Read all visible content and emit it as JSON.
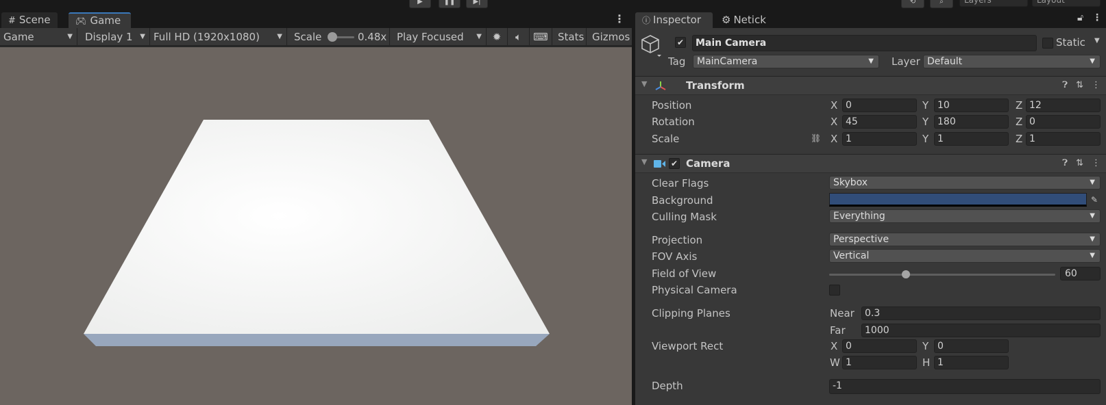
{
  "toolbar": {
    "play": "▶",
    "pause": "❚❚",
    "step": "▶|",
    "layers": "Layers",
    "layout": "Layout"
  },
  "game_panel": {
    "tabs": [
      {
        "label": "Scene",
        "icon": "grid-icon"
      },
      {
        "label": "Game",
        "icon": "gamepad-icon"
      }
    ],
    "toolbar": {
      "mode": "Game",
      "display": "Display 1",
      "resolution": "Full HD (1920x1080)",
      "scale_label": "Scale",
      "scale_value": "0.48x",
      "scale_fraction": 0.1,
      "play_mode": "Play Focused",
      "stats": "Stats",
      "gizmos": "Gizmos"
    }
  },
  "inspector": {
    "tabs": [
      {
        "label": "Inspector",
        "icon": "info-icon"
      },
      {
        "label": "Netick",
        "icon": "gear-icon"
      }
    ],
    "object": {
      "name": "Main Camera",
      "active": true,
      "static_label": "Static",
      "tag_label": "Tag",
      "tag": "MainCamera",
      "layer_label": "Layer",
      "layer": "Default"
    },
    "transform": {
      "title": "Transform",
      "position_label": "Position",
      "rotation_label": "Rotation",
      "scale_label": "Scale",
      "position": {
        "x": "0",
        "y": "10",
        "z": "12"
      },
      "rotation": {
        "x": "45",
        "y": "180",
        "z": "0"
      },
      "scale": {
        "x": "1",
        "y": "1",
        "z": "1"
      },
      "axis_x": "X",
      "axis_y": "Y",
      "axis_z": "Z"
    },
    "camera": {
      "title": "Camera",
      "enabled": true,
      "clear_flags_label": "Clear Flags",
      "clear_flags": "Skybox",
      "background_label": "Background",
      "background_color": "#314d79",
      "culling_mask_label": "Culling Mask",
      "culling_mask": "Everything",
      "projection_label": "Projection",
      "projection": "Perspective",
      "fov_axis_label": "FOV Axis",
      "fov_axis": "Vertical",
      "fov_label": "Field of View",
      "fov_value": "60",
      "fov_fraction": 0.34,
      "physical_label": "Physical Camera",
      "clipping_label": "Clipping Planes",
      "near_label": "Near",
      "near": "0.3",
      "far_label": "Far",
      "far": "1000",
      "viewport_label": "Viewport Rect",
      "vp_x_label": "X",
      "vp_x": "0",
      "vp_y_label": "Y",
      "vp_y": "0",
      "vp_w_label": "W",
      "vp_w": "1",
      "vp_h_label": "H",
      "vp_h": "1",
      "depth_label": "Depth",
      "depth": "-1"
    }
  }
}
